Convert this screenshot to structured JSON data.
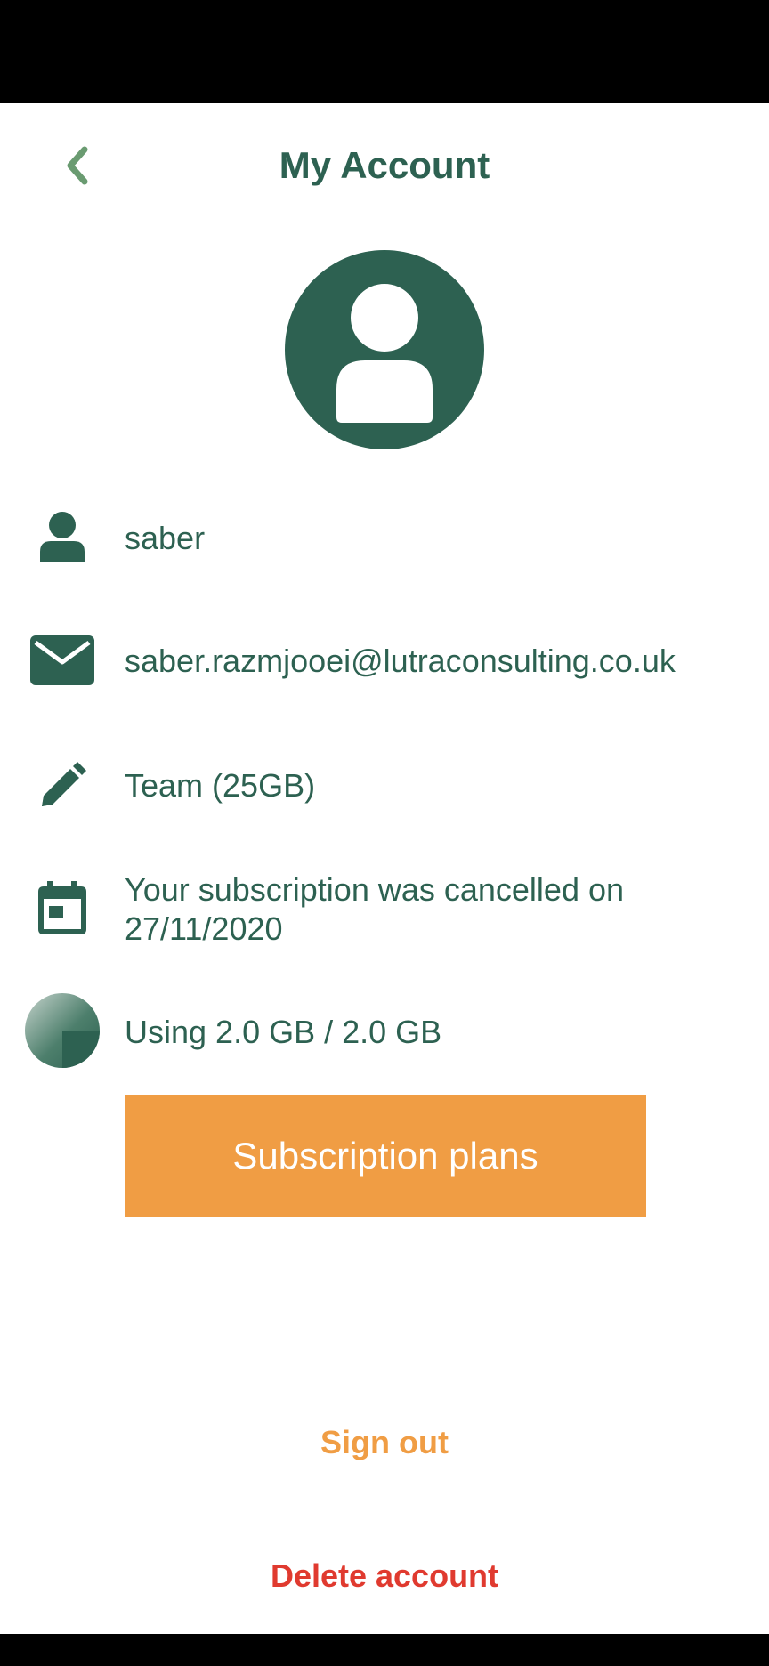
{
  "colors": {
    "primary": "#2d6151",
    "accent": "#f09d44",
    "danger": "#e03a2f"
  },
  "header": {
    "title": "My Account",
    "back_icon": "chevron-left-icon"
  },
  "avatar": {
    "icon": "user-avatar-icon"
  },
  "details": {
    "username": {
      "icon": "person-icon",
      "value": "saber"
    },
    "email": {
      "icon": "envelope-icon",
      "value": "saber.razmjooei@lutraconsulting.co.uk"
    },
    "plan": {
      "icon": "pencil-icon",
      "value": "Team (25GB)"
    },
    "subscription": {
      "icon": "calendar-icon",
      "value": "Your subscription was cancelled on 27/11/2020"
    },
    "storage": {
      "icon": "storage-pie-icon",
      "value": "Using 2.0 GB / 2.0 GB",
      "used_fraction": 1.0
    }
  },
  "actions": {
    "subscription_plans": "Subscription plans",
    "sign_out": "Sign out",
    "delete_account": "Delete account"
  }
}
